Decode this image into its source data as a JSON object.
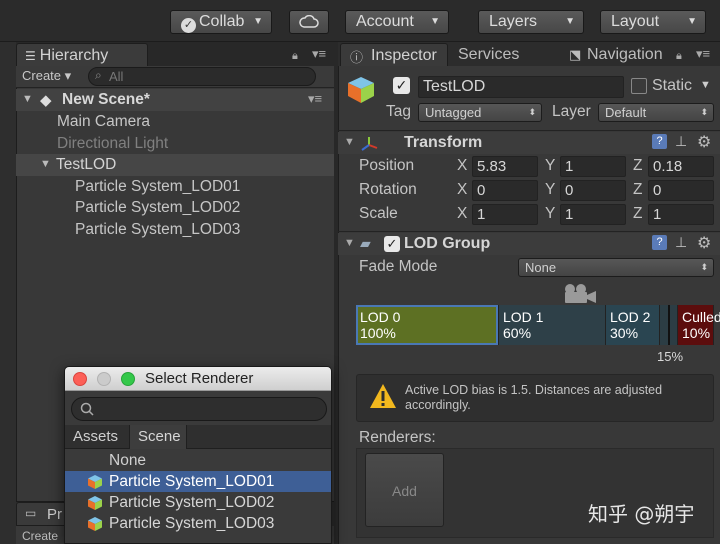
{
  "toolbar": {
    "collab": "Collab",
    "account": "Account",
    "layers": "Layers",
    "layout": "Layout"
  },
  "hierarchy": {
    "tab": "Hierarchy",
    "create": "Create",
    "search_placeholder": "All",
    "scene_name": "New Scene*",
    "items": [
      "Main Camera",
      "Directional Light",
      "TestLOD",
      "Particle System_LOD01",
      "Particle System_LOD02",
      "Particle System_LOD03"
    ],
    "bottom_tab": "Pr",
    "bottom_create": "Create"
  },
  "inspector": {
    "tabs": {
      "inspector": "Inspector",
      "services": "Services",
      "navigation": "Navigation"
    },
    "object_name": "TestLOD",
    "static_label": "Static",
    "tag_label": "Tag",
    "tag_value": "Untagged",
    "layer_label": "Layer",
    "layer_value": "Default",
    "transform": {
      "title": "Transform",
      "position_label": "Position",
      "position": {
        "x": "5.83",
        "y": "1",
        "z": "0.18"
      },
      "rotation_label": "Rotation",
      "rotation": {
        "x": "0",
        "y": "0",
        "z": "0"
      },
      "scale_label": "Scale",
      "scale": {
        "x": "1",
        "y": "1",
        "z": "1"
      },
      "axis_x": "X",
      "axis_y": "Y",
      "axis_z": "Z"
    },
    "lod_group": {
      "title": "LOD Group",
      "fade_mode_label": "Fade Mode",
      "fade_mode_value": "None",
      "levels": [
        {
          "name": "LOD 0",
          "pct": "100%",
          "fraction": 0.4,
          "color": "#5d7023"
        },
        {
          "name": "LOD 1",
          "pct": "60%",
          "fraction": 0.3,
          "color": "#2e4048"
        },
        {
          "name": "LOD 2",
          "pct": "30%",
          "fraction": 0.15,
          "color": "#2a4551"
        },
        {
          "name": "",
          "pct": "",
          "fraction": 0.05,
          "color": "#2c3d44"
        },
        {
          "name": "Culled",
          "pct": "10%",
          "fraction": 0.1,
          "color": "#5c0d0d"
        }
      ],
      "camera_pct": "15%",
      "warning": "Active LOD bias is 1.5. Distances are adjusted accordingly.",
      "renderers_label": "Renderers:",
      "add_label": "Add"
    }
  },
  "dialog": {
    "title": "Select Renderer",
    "search_placeholder": "",
    "tabs": {
      "assets": "Assets",
      "scene": "Scene"
    },
    "items": [
      "None",
      "Particle System_LOD01",
      "Particle System_LOD02",
      "Particle System_LOD03"
    ],
    "selected_index": 1
  },
  "watermark": "知乎 @朔宇"
}
